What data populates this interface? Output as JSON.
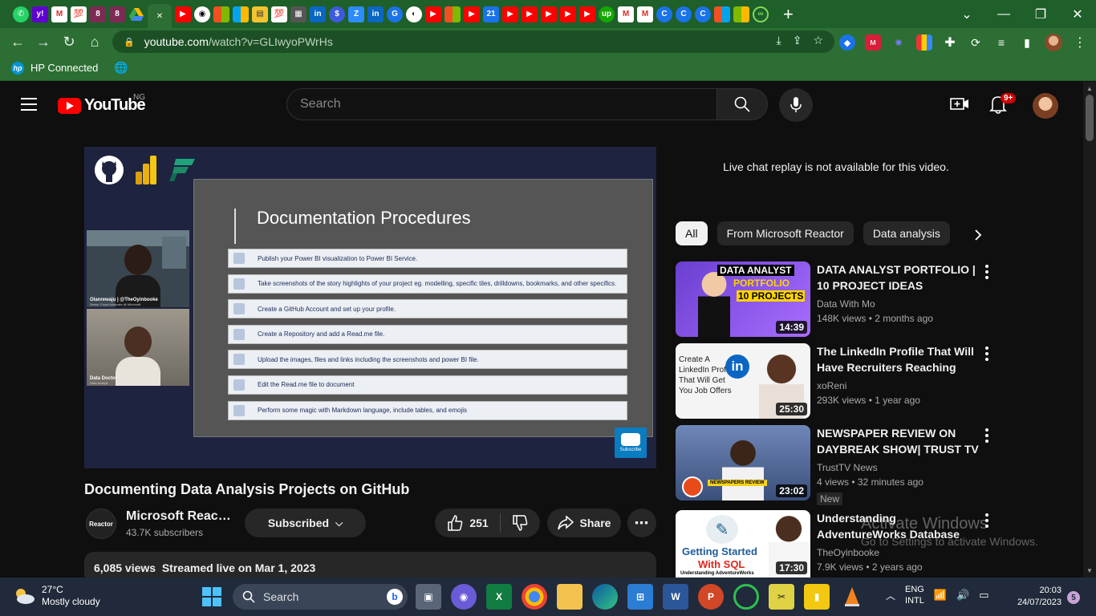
{
  "browser": {
    "url_host": "youtube.com",
    "url_path": "/watch?v=GLIwyoPWrHs",
    "bookmarks": [
      {
        "label": "HP Connected"
      }
    ],
    "new_tab": "+",
    "window_controls": {
      "minimize": "—",
      "maximize": "❐",
      "close": "✕"
    }
  },
  "youtube": {
    "logo_text": "YouTube",
    "country_code": "NG",
    "search_placeholder": "Search",
    "notification_count": "9+"
  },
  "video": {
    "slide_title": "Documentation Procedures",
    "slide_items": [
      "Publish your Power BI visualization to Power BI Service.",
      "Take screenshots of the story highlights of your project eg. modelling, specific tiles, drilldowns, bookmarks, and other specifics.",
      "Create a GitHub Account and set up your profile.",
      "Create a Repository and add a Read.me file.",
      "Upload the images, files and links including the screenshots and power BI file.",
      "Edit the Read.me file to document",
      "Perform some magic with Markdown language, include tables, and emojis"
    ],
    "presenter1_name": "Olanrewaju | @TheOyinbooke",
    "presenter1_role": "Senior Cloud Advocate @ Microsoft",
    "presenter2_name": "Data Doctor",
    "presenter2_role": "Data Analyst",
    "watermark_label": "Subscribe",
    "title": "Documenting Data Analysis Projects on GitHub",
    "channel_name": "Microsoft Reac…",
    "channel_avatar_text": "Reactor",
    "subscribers": "43.7K subscribers",
    "subscribed_label": "Subscribed",
    "likes": "251",
    "share_label": "Share",
    "views": "6,085 views",
    "streamed": "Streamed live on Mar 1, 2023"
  },
  "sidebar": {
    "chat_notice": "Live chat replay is not available for this video.",
    "chips": [
      "All",
      "From Microsoft Reactor",
      "Data analysis"
    ],
    "recommendations": [
      {
        "title": "DATA ANALYST PORTFOLIO | 10 PROJECT IDEAS",
        "channel": "Data With Mo",
        "meta": "148K views • 2 months ago",
        "duration": "14:39",
        "thumb_text1": "DATA ANALYST",
        "thumb_text2": "PORTFOLIO",
        "thumb_text3": "10 PROJECTS"
      },
      {
        "title": "The LinkedIn Profile That Will Have Recruiters Reaching Out…",
        "channel": "xoReni",
        "meta": "293K views • 1 year ago",
        "duration": "25:30",
        "thumb_text1": "Create A LinkedIn Profile That Will Get You Job Offers"
      },
      {
        "title": "NEWSPAPER REVIEW ON DAYBREAK SHOW| TRUST TV",
        "channel": "TrustTV News",
        "meta": "4 views • 32 minutes ago",
        "duration": "23:02",
        "badge": "New",
        "thumb_text1": "NEWSPAPERS REVIEW"
      },
      {
        "title": "Understanding AdventureWorks Database Schema || Beginner…",
        "channel": "TheOyinbooke",
        "meta": "7.9K views • 2 years ago",
        "duration": "17:30",
        "thumb_text1": "Getting Started",
        "thumb_text2": "With SQL",
        "thumb_text3": "Understanding AdventureWorks"
      }
    ]
  },
  "windows_activation": {
    "line1": "Activate Windows",
    "line2": "Go to Settings to activate Windows."
  },
  "taskbar": {
    "temperature": "27°C",
    "weather": "Mostly cloudy",
    "search_placeholder": "Search",
    "lang1": "ENG",
    "lang2": "INTL",
    "time": "20:03",
    "date": "24/07/2023",
    "notif_count": "5"
  }
}
